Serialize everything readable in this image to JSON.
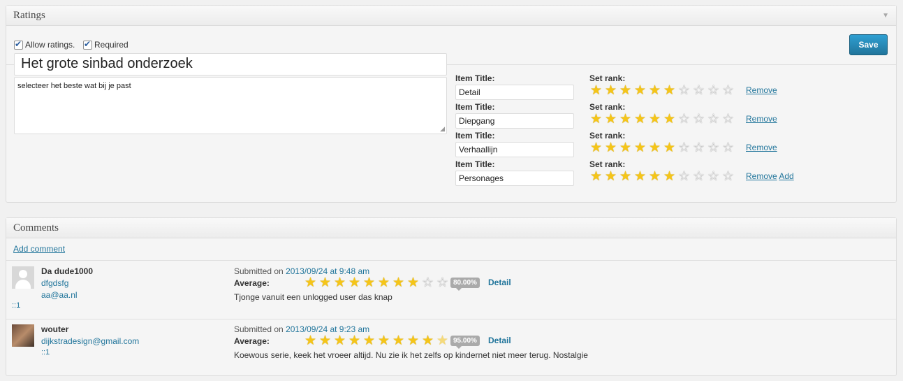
{
  "ratings": {
    "title": "Ratings",
    "allow_ratings_label": "Allow ratings.",
    "required_label": "Required",
    "save_label": "Save",
    "survey_title": "Het grote sinbad onderzoek",
    "survey_description": "selecteer het beste wat bij je past",
    "item_title_label": "Item Title:",
    "set_rank_label": "Set rank:",
    "remove_label": "Remove",
    "add_label": "Add",
    "items": [
      {
        "title": "Detail",
        "rank": 6,
        "max": 10
      },
      {
        "title": "Diepgang",
        "rank": 6,
        "max": 10
      },
      {
        "title": "Verhaallijn",
        "rank": 6,
        "max": 10
      },
      {
        "title": "Personages",
        "rank": 6,
        "max": 10
      }
    ]
  },
  "comments": {
    "title": "Comments",
    "add_comment_label": "Add comment",
    "submitted_on_label": "Submitted on",
    "average_label": "Average:",
    "detail_label": "Detail",
    "list": [
      {
        "author": "Da dude1000",
        "line1": "dfgdsfg",
        "line2": "aa@aa.nl",
        "ip": "::1",
        "date": "2013/09/24 at 9:48 am",
        "stars": 8,
        "max": 10,
        "percent": "80.00%",
        "text": "Tjonge vanuit een unlogged user das knap",
        "avatar": "default"
      },
      {
        "author": "wouter",
        "line1": "dijkstradesign@gmail.com",
        "line2": "::1",
        "ip": "",
        "date": "2013/09/24 at 9:23 am",
        "stars": 9.5,
        "max": 10,
        "percent": "95.00%",
        "text": "Koewous serie, keek het vroeer altijd. Nu zie ik het zelfs op kindernet niet meer terug. Nostalgie",
        "avatar": "photo"
      }
    ]
  },
  "colors": {
    "accent": "#21759b",
    "star": "#f5c518"
  }
}
